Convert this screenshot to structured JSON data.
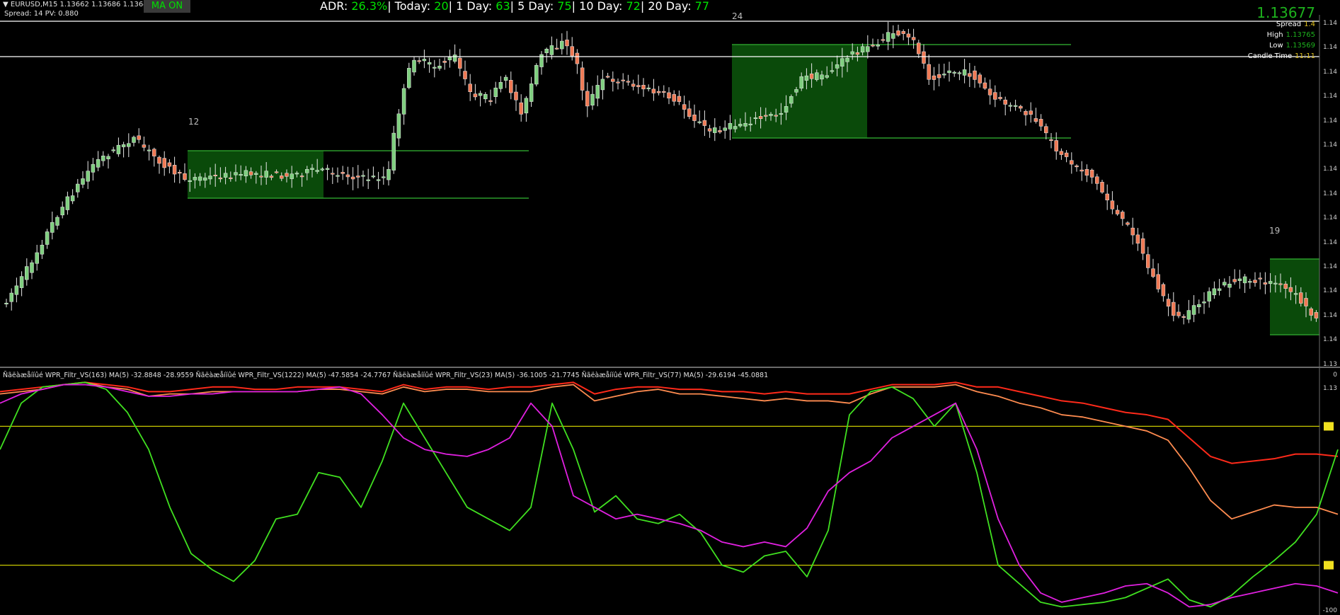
{
  "header": {
    "symbol_line": "▼ EURUSD,M15  1.13662 1.13686 1.13643 1.13677",
    "sub_line": "Spread: 14    PV: 0.880",
    "ma_button": "MA ON"
  },
  "adr": {
    "adr_label": "ADR: ",
    "adr_value": "26.3%",
    "today_label": "| Today: ",
    "today_value": "20",
    "d1_label": "| 1 Day: ",
    "d1_value": "63",
    "d5_label": "| 5 Day: ",
    "d5_value": "75",
    "d10_label": "| 10 Day: ",
    "d10_value": "72",
    "d20_label": "|   20 Day: ",
    "d20_value": "77"
  },
  "price_panel": {
    "big_price": "1.13677",
    "spread_label": "Spread",
    "spread_value": "1.4",
    "high_label": "High",
    "high_value": "1.13765",
    "low_label": "Low",
    "low_value": "1.13569",
    "candle_time_label": "Candle Time",
    "candle_time_value": "11:11",
    "axis_labels": [
      "1.14",
      "1.14",
      "1.14",
      "1.14",
      "1.14",
      "1.14",
      "1.14",
      "1.14",
      "1.14",
      "1.14",
      "1.14",
      "1.14",
      "1.14",
      "1.14",
      "1.13",
      "1.13"
    ]
  },
  "box_counts": [
    "12",
    "24",
    "19"
  ],
  "indicator": {
    "header": "Ñãëàæåííûé WPR_Filtr_VS(163) MA(5) -32.8848 -28.9559  Ñãëàæåííûé WPR_Filtr_VS(1222) MA(5) -47.5854 -24.7767  Ñãëàæåííûé WPR_Filtr_VS(23) MA(5) -36.1005 -21.7745  Ñãëàæåííûé WPR_Filtr_VS(77) MA(5) -29.6194 -45.0881",
    "axis_top": "0",
    "axis_bottom": "-100"
  },
  "colors": {
    "bull": "#7fcf7f",
    "bear": "#f07a55",
    "box": "#0a4a0a",
    "box_border": "#2a9a2a",
    "level": "#c8c800",
    "line_red": "#ff2a1a",
    "line_orange": "#ff8c50",
    "line_green": "#40e020",
    "line_magenta": "#e020e0"
  },
  "chart_data": {
    "type": "line",
    "ylim": [
      -100,
      0
    ],
    "levels": [
      -20,
      -80
    ],
    "x": [
      0,
      30,
      60,
      90,
      120,
      150,
      180,
      210,
      240,
      270,
      300,
      330,
      360,
      390,
      420,
      450,
      480,
      510,
      540,
      570,
      600,
      630,
      660,
      690,
      720,
      750,
      780,
      810,
      840,
      870,
      900,
      930,
      960,
      990,
      1020,
      1050,
      1080,
      1110,
      1140,
      1170,
      1200,
      1230,
      1260,
      1290,
      1320,
      1350,
      1380,
      1410,
      1440,
      1470,
      1500,
      1530,
      1560,
      1590,
      1620,
      1650,
      1680,
      1710,
      1740,
      1770,
      1800,
      1830,
      1860,
      1890
    ],
    "series": [
      {
        "values": [
          -5,
          -4,
          -3,
          -2,
          -1,
          -2,
          -3,
          -5,
          -5,
          -4,
          -3,
          -3,
          -4,
          -4,
          -3,
          -3,
          -3,
          -4,
          -5,
          -2,
          -4,
          -3,
          -3,
          -4,
          -3,
          -3,
          -2,
          -1,
          -6,
          -4,
          -3,
          -3,
          -4,
          -4,
          -5,
          -5,
          -6,
          -5,
          -6,
          -6,
          -6,
          -4,
          -2,
          -2,
          -2,
          -1,
          -3,
          -3,
          -5,
          -7,
          -9,
          -10,
          -12,
          -14,
          -15,
          -17,
          -25,
          -33,
          -36,
          -35,
          -34,
          -32,
          -32,
          -33
        ]
      },
      {
        "values": [
          -6,
          -5,
          -4,
          -2,
          -1,
          -3,
          -4,
          -7,
          -6,
          -6,
          -5,
          -5,
          -5,
          -5,
          -5,
          -4,
          -4,
          -5,
          -6,
          -3,
          -5,
          -4,
          -4,
          -5,
          -5,
          -5,
          -3,
          -2,
          -9,
          -7,
          -5,
          -4,
          -6,
          -6,
          -7,
          -8,
          -9,
          -8,
          -9,
          -9,
          -10,
          -6,
          -3,
          -3,
          -3,
          -2,
          -5,
          -7,
          -10,
          -12,
          -15,
          -16,
          -18,
          -20,
          -22,
          -26,
          -38,
          -52,
          -60,
          -57,
          -54,
          -55,
          -55,
          -58
        ]
      },
      {
        "values": [
          -30,
          -10,
          -3,
          -2,
          -1,
          -4,
          -14,
          -30,
          -55,
          -75,
          -82,
          -87,
          -78,
          -60,
          -58,
          -40,
          -42,
          -55,
          -35,
          -10,
          -25,
          -40,
          -55,
          -60,
          -65,
          -55,
          -10,
          -30,
          -57,
          -50,
          -60,
          -62,
          -58,
          -66,
          -80,
          -83,
          -76,
          -74,
          -85,
          -65,
          -15,
          -5,
          -3,
          -8,
          -20,
          -10,
          -40,
          -80,
          -88,
          -96,
          -98,
          -97,
          -96,
          -94,
          -90,
          -86,
          -95,
          -98,
          -93,
          -85,
          -78,
          -70,
          -58,
          -30
        ]
      },
      {
        "values": [
          -10,
          -6,
          -4,
          -2,
          -2,
          -3,
          -5,
          -7,
          -7,
          -6,
          -6,
          -5,
          -5,
          -5,
          -5,
          -4,
          -3,
          -6,
          -15,
          -25,
          -30,
          -32,
          -33,
          -30,
          -25,
          -10,
          -20,
          -50,
          -55,
          -60,
          -58,
          -60,
          -62,
          -65,
          -70,
          -72,
          -70,
          -72,
          -64,
          -48,
          -40,
          -35,
          -25,
          -20,
          -15,
          -10,
          -30,
          -60,
          -80,
          -92,
          -96,
          -94,
          -92,
          -89,
          -88,
          -92,
          -98,
          -97,
          -94,
          -92,
          -90,
          -88,
          -89,
          -92
        ]
      }
    ]
  }
}
